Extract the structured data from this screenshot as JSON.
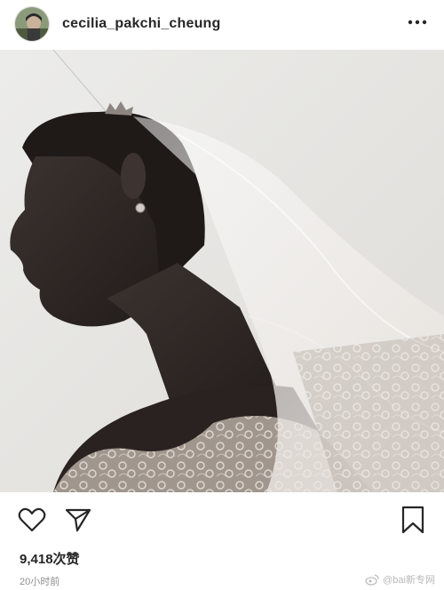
{
  "post": {
    "username": "cecilia_pakchi_cheung",
    "likes_text": "9,418次赞",
    "timestamp": "20小时前"
  },
  "icons": {
    "more": "more-options-icon",
    "like": "heart-icon",
    "share": "paper-plane-icon",
    "save": "bookmark-icon"
  },
  "photo": {
    "description_icon": "bride-photo"
  },
  "watermark": {
    "text": "@bai新专网"
  }
}
